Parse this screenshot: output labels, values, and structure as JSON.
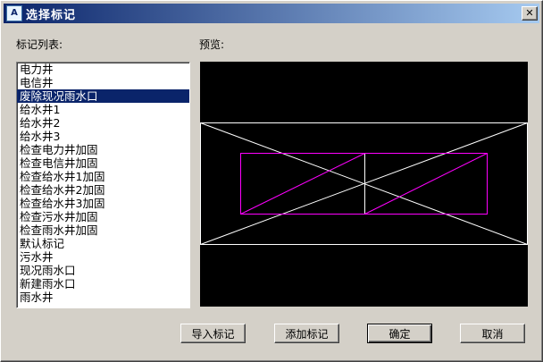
{
  "window": {
    "title": "选择标记",
    "close_glyph": "✕"
  },
  "labels": {
    "list": "标记列表:",
    "preview": "预览:"
  },
  "list_items": [
    {
      "label": "电力井",
      "selected": false
    },
    {
      "label": "电信井",
      "selected": false
    },
    {
      "label": "废除现况雨水口",
      "selected": true
    },
    {
      "label": "给水井1",
      "selected": false
    },
    {
      "label": "给水井2",
      "selected": false
    },
    {
      "label": "给水井3",
      "selected": false
    },
    {
      "label": "检查电力井加固",
      "selected": false
    },
    {
      "label": "检查电信井加固",
      "selected": false
    },
    {
      "label": "检查给水井1加固",
      "selected": false
    },
    {
      "label": "检查给水井2加固",
      "selected": false
    },
    {
      "label": "检查给水井3加固",
      "selected": false
    },
    {
      "label": "检查污水井加固",
      "selected": false
    },
    {
      "label": "检查雨水井加固",
      "selected": false
    },
    {
      "label": "默认标记",
      "selected": false
    },
    {
      "label": "污水井",
      "selected": false
    },
    {
      "label": "现况雨水口",
      "selected": false
    },
    {
      "label": "新建雨水口",
      "selected": false
    },
    {
      "label": "雨水井",
      "selected": false
    }
  ],
  "buttons": {
    "import": "导入标记",
    "add": "添加标记",
    "ok": "确定",
    "cancel": "取消"
  },
  "colors": {
    "preview_bg": "#000000",
    "outer_lines": "#ffffff",
    "symbol_lines": "#ff00ff",
    "selection": "#0a246a"
  }
}
